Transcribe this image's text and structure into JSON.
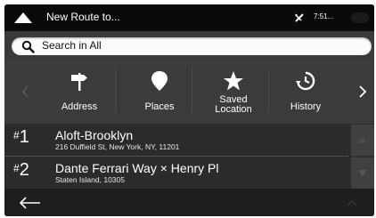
{
  "header": {
    "title": "New Route to...",
    "clock": "7:51...",
    "icons": {
      "back": "triangle-up-icon",
      "gps": "satellite-icon",
      "battery": "battery-icon"
    }
  },
  "search": {
    "label": "Search in All",
    "icon": "search-icon"
  },
  "categories": [
    {
      "label_lines": [
        "Address"
      ],
      "icon": "signpost-icon"
    },
    {
      "label_lines": [
        "Places"
      ],
      "icon": "map-pin-icon"
    },
    {
      "label_lines": [
        "Saved",
        "Location"
      ],
      "icon": "star-icon"
    },
    {
      "label_lines": [
        "History"
      ],
      "icon": "clock-history-icon"
    }
  ],
  "results": [
    {
      "rank": "1",
      "name": "Aloft-Brooklyn",
      "address": "216 Duffield St, New York, NY, 11201"
    },
    {
      "rank": "2",
      "name": "Dante Ferrari Way × Henry Pl",
      "address": "Staten Island, 10305"
    }
  ],
  "footer": {
    "back_icon": "arrow-left-icon",
    "up_icon": "chevron-up-icon"
  },
  "colors": {
    "background": "#333333",
    "topbar": "#0a0a0a",
    "text": "#ffffff"
  }
}
